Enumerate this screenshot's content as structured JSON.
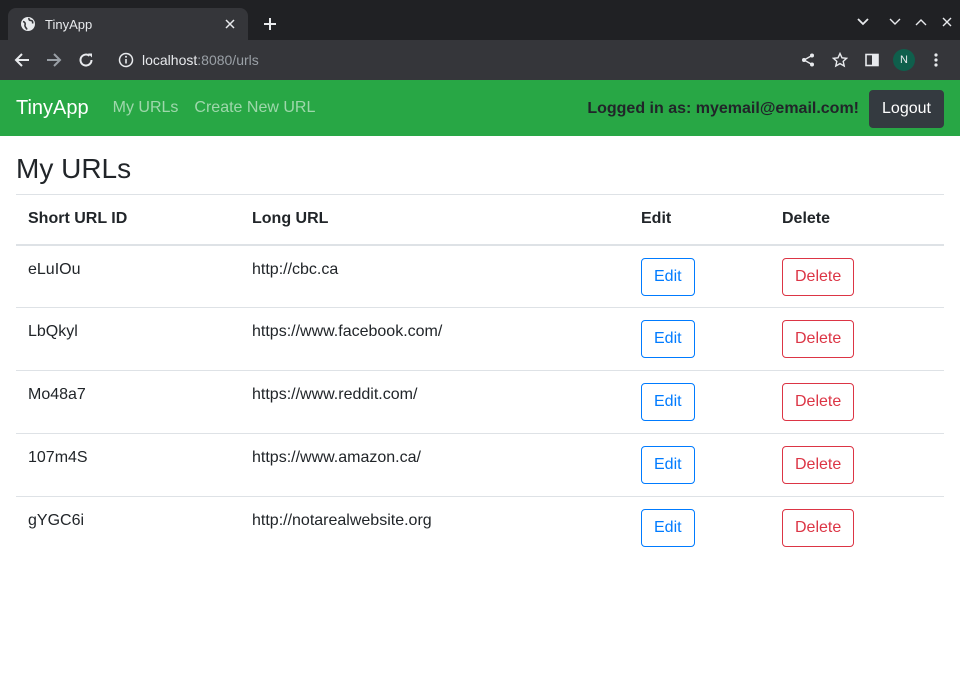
{
  "browser": {
    "tab_title": "TinyApp",
    "url_host": "localhost",
    "url_rest": ":8080/urls",
    "profile_initial": "N"
  },
  "navbar": {
    "brand": "TinyApp",
    "links": [
      "My URLs",
      "Create New URL"
    ],
    "logged_in_text": "Logged in as: myemail@email.com!",
    "logout_label": "Logout"
  },
  "main": {
    "title": "My URLs",
    "columns": [
      "Short URL ID",
      "Long URL",
      "Edit",
      "Delete"
    ],
    "edit_label": "Edit",
    "delete_label": "Delete",
    "rows": [
      {
        "short_id": "eLuIOu",
        "long_url": "http://cbc.ca"
      },
      {
        "short_id": "LbQkyl",
        "long_url": "https://www.facebook.com/"
      },
      {
        "short_id": "Mo48a7",
        "long_url": "https://www.reddit.com/"
      },
      {
        "short_id": "107m4S",
        "long_url": "https://www.amazon.ca/"
      },
      {
        "short_id": "gYGC6i",
        "long_url": "http://notarealwebsite.org"
      }
    ]
  },
  "colors": {
    "navbar_bg": "#28a745",
    "edit": "#007bff",
    "delete": "#dc3545",
    "logout_bg": "#343a40"
  }
}
